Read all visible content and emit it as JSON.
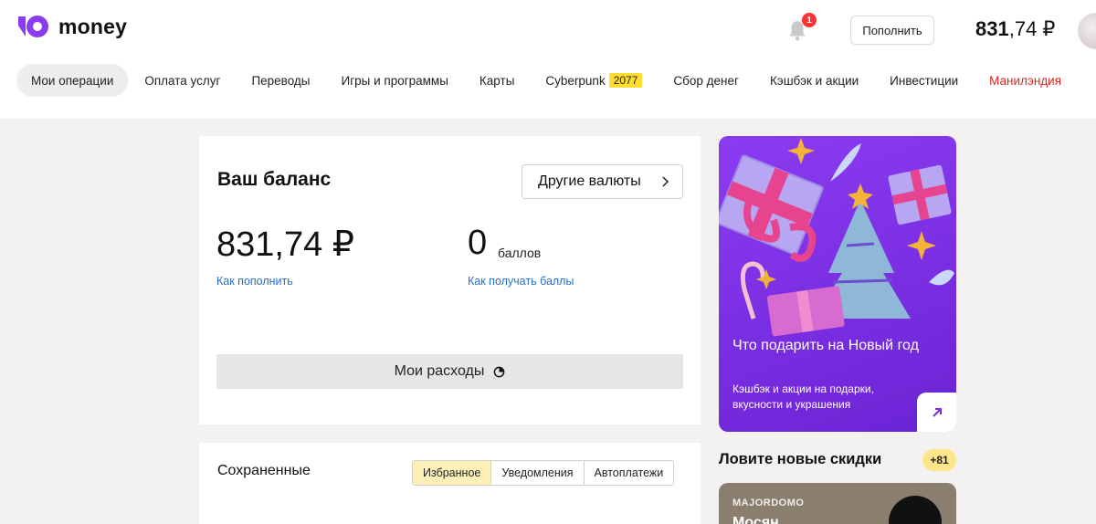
{
  "header": {
    "logo_text": "money",
    "notification_count": "1",
    "topup_label": "Пополнить",
    "balance_main": "831",
    "balance_rest": ",74 ₽"
  },
  "nav": {
    "items": [
      {
        "label": "Мои операции"
      },
      {
        "label": "Оплата услуг"
      },
      {
        "label": "Переводы"
      },
      {
        "label": "Игры и программы"
      },
      {
        "label": "Карты"
      },
      {
        "label": "Cyberpunk",
        "tag": "2077"
      },
      {
        "label": "Сбор денег"
      },
      {
        "label": "Кэшбэк и акции"
      },
      {
        "label": "Инвестиции"
      },
      {
        "label": "Манилэндия"
      }
    ]
  },
  "balance": {
    "title": "Ваш баланс",
    "other_currencies": "Другие валюты",
    "amount": "831,74 ₽",
    "topup_link": "Как пополнить",
    "points": "0",
    "points_unit": "баллов",
    "points_link": "Как получать баллы",
    "expenses": "Мои расходы"
  },
  "saved": {
    "title": "Сохраненные",
    "tabs": [
      "Избранное",
      "Уведомления",
      "Автоплатежи"
    ]
  },
  "promo": {
    "title": "Что подарить на Новый год",
    "subtitle": "Кэшбэк и акции на подарки, вкусности и украшения"
  },
  "discounts": {
    "title": "Ловите новые скидки",
    "badge": "+81",
    "card_brand": "MAJORDOMO",
    "card_name": "Мосян"
  },
  "colors": {
    "accent_purple": "#8c3cf0",
    "link_blue": "#2a6dc9",
    "highlight_yellow": "#ffdc2e",
    "red": "#e0251e"
  }
}
